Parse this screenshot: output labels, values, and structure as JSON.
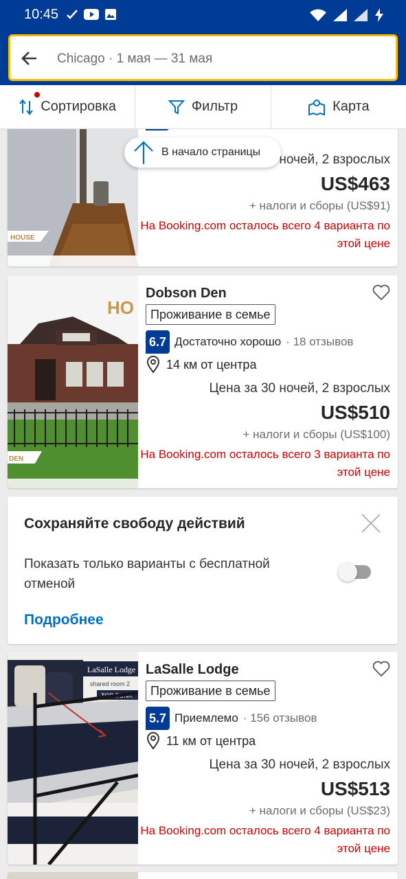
{
  "status_bar": {
    "time": "10:45"
  },
  "search": {
    "query": "Chicago · 1 мая — 31 мая"
  },
  "tabs": {
    "sort": "Сортировка",
    "filter": "Фильтр",
    "map": "Карта"
  },
  "scroll_to_top": "В начало страницы",
  "colors": {
    "brand": "#003b95",
    "accent": "#febb02",
    "link": "#0071c2",
    "alert": "#cc0000"
  },
  "listings": [
    {
      "photo_caption": "HOUSE",
      "price_title": "Цена за 30 ночей, 2 взрослых",
      "price": "US$463",
      "taxes": "+ налоги и сборы (US$91)",
      "availability": "На Booking.com осталось всего 4 варианта по этой цене"
    },
    {
      "name": "Dobson Den",
      "type": "Проживание в семье",
      "score": "6.7",
      "score_label": "Достаточно хорошо",
      "reviews": "· 18 отзывов",
      "distance": "14 км от центра",
      "photo_caption": "DEN",
      "photo_sign": "HO",
      "price_title": "Цена за 30 ночей, 2 взрослых",
      "price": "US$510",
      "taxes": "+ налоги и сборы (US$100)",
      "availability": "На Booking.com осталось всего 3 варианта по этой цене"
    },
    {
      "name": "LaSalle Lodge",
      "type": "Проживание в семье",
      "score": "5.7",
      "score_label": "Приемлемо",
      "reviews": "· 156 отзывов",
      "distance": "11 км от центра",
      "photo_sign": "LaSalle Lodge",
      "photo_sub": "shared room 2",
      "photo_tag": "TOP BUNK",
      "price_title": "Цена за 30 ночей, 2 взрослых",
      "price": "US$513",
      "taxes": "+ налоги и сборы (US$23)",
      "availability": "На Booking.com осталось всего 4 варианта по этой цене"
    }
  ],
  "promo": {
    "title": "Сохраняйте свободу действий",
    "description": "Показать только варианты с бесплатной отменой",
    "toggle_on": false,
    "more_link": "Подробнее"
  }
}
